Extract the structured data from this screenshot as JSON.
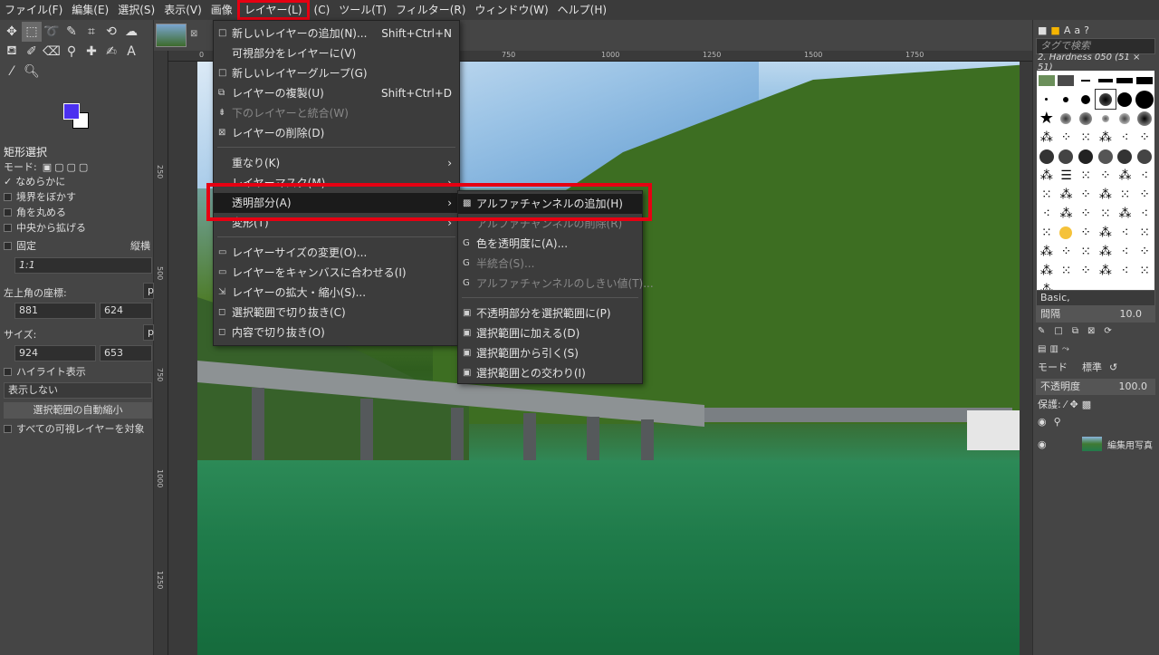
{
  "menubar": [
    "ファイル(F)",
    "編集(E)",
    "選択(S)",
    "表示(V)",
    "画像",
    "レイヤー(L)",
    "(C)",
    "ツール(T)",
    "フィルター(R)",
    "ウィンドウ(W)",
    "ヘルプ(H)"
  ],
  "tool_options": {
    "title": "矩形選択",
    "mode_label": "モード:",
    "antialias": "なめらかに",
    "feather": "境界をぼかす",
    "round": "角を丸める",
    "expand_center": "中央から拡げる",
    "fixed": "固定",
    "fixed_mode": "縦横",
    "ratio": "1:1",
    "position_label": "左上角の座標:",
    "pos_x": "881",
    "pos_y": "624",
    "size_label": "サイズ:",
    "size_w": "924",
    "size_h": "653",
    "unit": "p",
    "highlight": "ハイライト表示",
    "guides": "表示しない",
    "autoshrink": "選択範囲の自動縮小",
    "sample_merged": "すべての可視レイヤーを対象"
  },
  "ruler_top": [
    "0",
    "750",
    "1000",
    "1250",
    "1500",
    "1750"
  ],
  "ruler_left": [
    "250",
    "500",
    "750",
    "1000",
    "1250"
  ],
  "layer_menu": {
    "items": [
      {
        "icon": "□",
        "label": "新しいレイヤーの追加(N)...",
        "shortcut": "Shift+Ctrl+N",
        "disabled": false
      },
      {
        "icon": "",
        "label": "可視部分をレイヤーに(V)",
        "shortcut": "",
        "disabled": false
      },
      {
        "icon": "□",
        "label": "新しいレイヤーグループ(G)",
        "shortcut": "",
        "disabled": false
      },
      {
        "icon": "⧉",
        "label": "レイヤーの複製(U)",
        "shortcut": "Shift+Ctrl+D",
        "disabled": false
      },
      {
        "icon": "⇟",
        "label": "下のレイヤーと統合(W)",
        "shortcut": "",
        "disabled": true
      },
      {
        "icon": "⊠",
        "label": "レイヤーの削除(D)",
        "shortcut": "",
        "disabled": false
      },
      {
        "icon": "",
        "label": "重なり(K)",
        "shortcut": "",
        "disabled": false,
        "sub": true
      },
      {
        "icon": "",
        "label": "レイヤーマスク(M)",
        "shortcut": "",
        "disabled": false,
        "sub": true
      },
      {
        "icon": "",
        "label": "透明部分(A)",
        "shortcut": "",
        "disabled": false,
        "sub": true
      },
      {
        "icon": "",
        "label": "変形(T)",
        "shortcut": "",
        "disabled": false,
        "sub": true
      },
      {
        "icon": "▭",
        "label": "レイヤーサイズの変更(O)...",
        "shortcut": "",
        "disabled": false
      },
      {
        "icon": "▭",
        "label": "レイヤーをキャンバスに合わせる(I)",
        "shortcut": "",
        "disabled": false
      },
      {
        "icon": "⇲",
        "label": "レイヤーの拡大・縮小(S)...",
        "shortcut": "",
        "disabled": false
      },
      {
        "icon": "◻",
        "label": "選択範囲で切り抜き(C)",
        "shortcut": "",
        "disabled": false
      },
      {
        "icon": "◻",
        "label": "内容で切り抜き(O)",
        "shortcut": "",
        "disabled": false
      }
    ]
  },
  "transparency_menu": {
    "items": [
      {
        "icon": "▩",
        "label": "アルファチャンネルの追加(H)",
        "disabled": false
      },
      {
        "icon": "",
        "label": "アルファチャンネルの削除(R)",
        "disabled": true
      },
      {
        "icon": "G",
        "label": "色を透明度に(A)...",
        "disabled": false
      },
      {
        "icon": "G",
        "label": "半統合(S)...",
        "disabled": true
      },
      {
        "icon": "G",
        "label": "アルファチャンネルのしきい値(T)...",
        "disabled": true
      },
      {
        "icon": "▣",
        "label": "不透明部分を選択範囲に(P)",
        "disabled": false
      },
      {
        "icon": "▣",
        "label": "選択範囲に加える(D)",
        "disabled": false
      },
      {
        "icon": "▣",
        "label": "選択範囲から引く(S)",
        "disabled": false
      },
      {
        "icon": "▣",
        "label": "選択範囲との交わり(I)",
        "disabled": false
      }
    ]
  },
  "brushes": {
    "tag_placeholder": "タグで検索",
    "current": "2. Hardness 050 (51 × 51)",
    "preset": "Basic,",
    "spacing_label": "間隔",
    "spacing": "10.0"
  },
  "layers": {
    "mode_label": "モード",
    "mode_value": "標準",
    "opacity_label": "不透明度",
    "opacity": "100.0",
    "lock_label": "保護:",
    "layer_name": "編集用写真"
  },
  "colors": {
    "fg": "#4b30f0",
    "bg": "#ffffff",
    "highlight": "#e60012"
  }
}
